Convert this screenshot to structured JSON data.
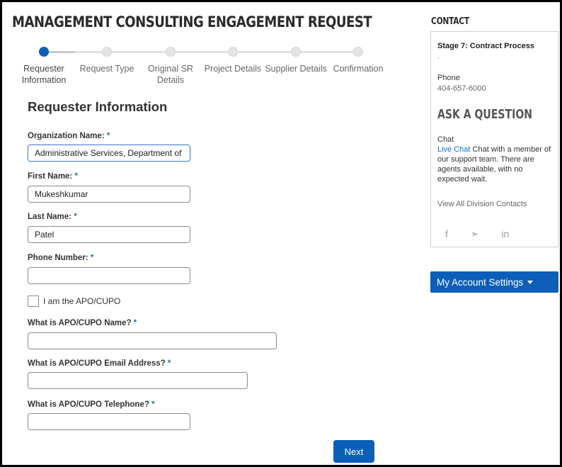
{
  "header": {
    "title": "MANAGEMENT CONSULTING ENGAGEMENT REQUEST"
  },
  "progress": {
    "current_step": 1,
    "steps": [
      {
        "label": "Requester Information"
      },
      {
        "label": "Request Type"
      },
      {
        "label": "Original SR Details"
      },
      {
        "label": "Project Details"
      },
      {
        "label": "Supplier Details"
      },
      {
        "label": "Confirmation"
      }
    ]
  },
  "form": {
    "section_title": "Requester Information",
    "required_marker": "*",
    "org": {
      "label": "Organization Name:",
      "value": "Administrative Services, Department of"
    },
    "first": {
      "label": "First Name:",
      "value": "Mukeshkumar"
    },
    "last": {
      "label": "Last Name:",
      "value": "Patel"
    },
    "phone": {
      "label": "Phone Number:",
      "value": ""
    },
    "apo_checkbox": {
      "label": "I am the APO/CUPO",
      "checked": false
    },
    "apo_name": {
      "label": "What is APO/CUPO Name?",
      "value": ""
    },
    "apo_email": {
      "label": "What is APO/CUPO Email Address?",
      "value": ""
    },
    "apo_phone": {
      "label": "What is APO/CUPO Telephone?",
      "value": ""
    },
    "next_label": "Next"
  },
  "sidebar": {
    "contact_heading": "CONTACT",
    "stage": "Stage 7: Contract Process",
    "dot": ".",
    "phone_label": "Phone",
    "phone_value": "404-657-6000",
    "ask_heading": "ASK A QUESTION",
    "chat_label": "Chat",
    "live_chat_link": "Live Chat",
    "chat_desc": "Chat with a member of our support team. There are agents available, with no expected wait.",
    "view_all_link": "View All Division Contacts",
    "social": {
      "facebook": "f",
      "twitter": "➣",
      "linkedin": "in"
    },
    "account_button": "My Account Settings"
  },
  "colors": {
    "primary": "#0b5fb8",
    "link": "#1a6fc2",
    "required": "#1a6fc2"
  }
}
